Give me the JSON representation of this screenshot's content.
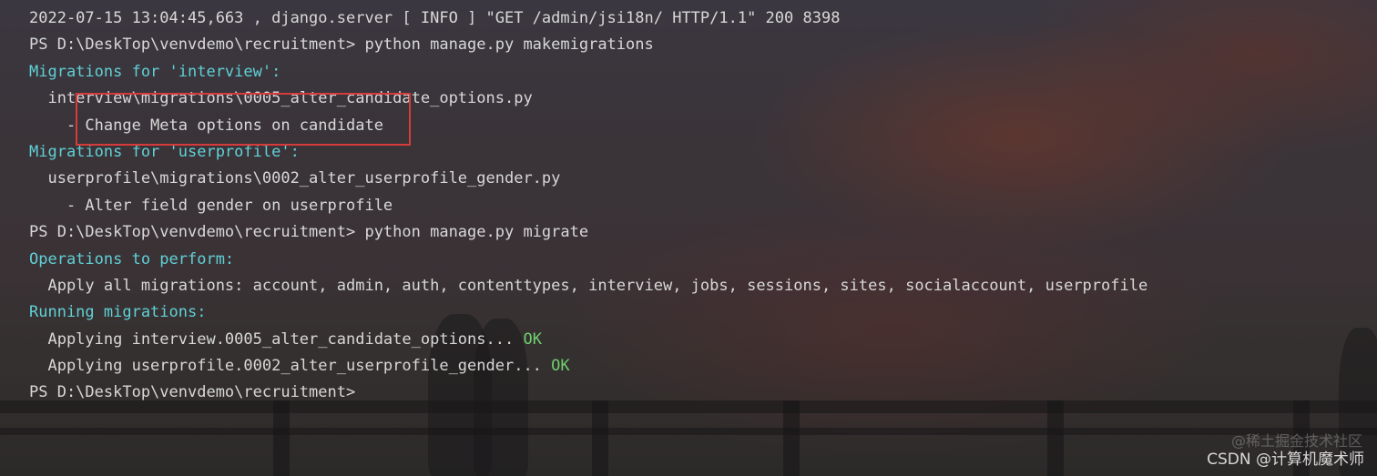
{
  "terminal": {
    "lines": [
      {
        "text": "2022-07-15 13:04:45,663 , django.server [ INFO ] \"GET /admin/jsi18n/ HTTP/1.1\" 200 8398",
        "segments": [
          {
            "t": "2022-07-15 13:04:45,663 , django.server [ INFO ] \"GET /admin/jsi18n/ HTTP/1.1\" 200 8398",
            "c": "white"
          }
        ]
      },
      {
        "segments": [
          {
            "t": "PS D:\\DeskTop\\venvdemo\\recruitment> python manage.py makemigrations",
            "c": "white"
          }
        ]
      },
      {
        "segments": [
          {
            "t": "Migrations for 'interview':",
            "c": "cyan"
          }
        ]
      },
      {
        "segments": [
          {
            "t": "  interview\\migrations\\0005_alter_candidate_options.py",
            "c": "white"
          }
        ]
      },
      {
        "segments": [
          {
            "t": "    - Change Meta options on candidate",
            "c": "white"
          }
        ]
      },
      {
        "segments": [
          {
            "t": "Migrations for 'userprofile':",
            "c": "cyan"
          }
        ]
      },
      {
        "segments": [
          {
            "t": "  userprofile\\migrations\\0002_alter_userprofile_gender.py",
            "c": "white"
          }
        ]
      },
      {
        "segments": [
          {
            "t": "    - Alter field gender on userprofile",
            "c": "white"
          }
        ]
      },
      {
        "segments": [
          {
            "t": "PS D:\\DeskTop\\venvdemo\\recruitment> python manage.py migrate",
            "c": "white"
          }
        ]
      },
      {
        "segments": [
          {
            "t": "Operations to perform:",
            "c": "cyan"
          }
        ]
      },
      {
        "segments": [
          {
            "t": "  Apply all migrations: ",
            "c": "white"
          },
          {
            "t": "account, admin, auth, contenttypes, interview, jobs, sessions, sites, socialaccount, userprofile",
            "c": "white"
          }
        ]
      },
      {
        "segments": [
          {
            "t": "Running migrations:",
            "c": "cyan"
          }
        ]
      },
      {
        "segments": [
          {
            "t": "  Applying interview.0005_alter_candidate_options... ",
            "c": "white"
          },
          {
            "t": "OK",
            "c": "green"
          }
        ]
      },
      {
        "segments": [
          {
            "t": "  Applying userprofile.0002_alter_userprofile_gender... ",
            "c": "white"
          },
          {
            "t": "OK",
            "c": "green"
          }
        ]
      },
      {
        "segments": [
          {
            "t": "PS D:\\DeskTop\\venvdemo\\recruitment>",
            "c": "white"
          }
        ]
      }
    ]
  },
  "watermark": {
    "text": "CSDN @计算机魔术师",
    "faint_text": "@稀土掘金技术社区"
  },
  "colors": {
    "cyan": "#5fd1d6",
    "green": "#6fcf6f",
    "white": "#d8d8d8",
    "highlight": "#d63b3b"
  }
}
